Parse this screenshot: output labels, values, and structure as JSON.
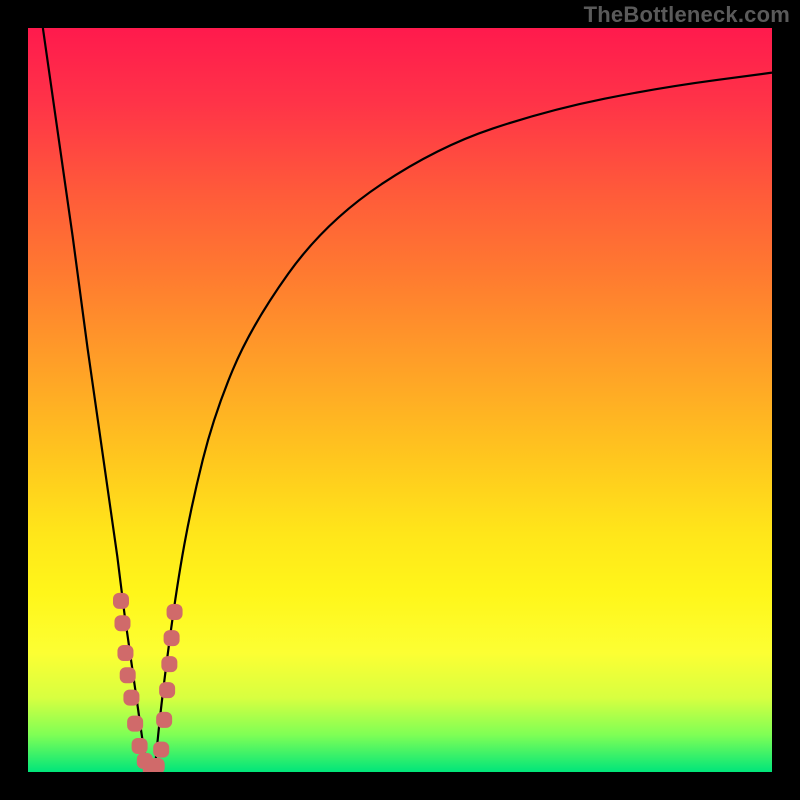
{
  "watermark": "TheBottleneck.com",
  "colors": {
    "frame": "#000000",
    "gradient_top": "#ff1a4d",
    "gradient_bottom": "#00e57a",
    "curve": "#000000",
    "marker": "#d06a6a"
  },
  "chart_data": {
    "type": "line",
    "title": "",
    "xlabel": "",
    "ylabel": "",
    "xlim": [
      0,
      100
    ],
    "ylim": [
      0,
      100
    ],
    "grid": false,
    "series": [
      {
        "name": "left-branch",
        "x": [
          2,
          4,
          6,
          8,
          10,
          12,
          13,
          14,
          15,
          16
        ],
        "values": [
          100,
          86,
          72,
          57,
          43,
          29,
          21,
          14,
          7,
          0
        ]
      },
      {
        "name": "right-branch",
        "x": [
          17,
          18,
          20,
          22,
          25,
          30,
          40,
          55,
          70,
          85,
          100
        ],
        "values": [
          0,
          10,
          25,
          36,
          48,
          60,
          74,
          84,
          89,
          92,
          94
        ]
      }
    ],
    "markers": [
      {
        "series": "left-branch",
        "x": 12.5,
        "y": 23
      },
      {
        "series": "left-branch",
        "x": 12.7,
        "y": 20
      },
      {
        "series": "left-branch",
        "x": 13.1,
        "y": 16
      },
      {
        "series": "left-branch",
        "x": 13.4,
        "y": 13
      },
      {
        "series": "left-branch",
        "x": 13.9,
        "y": 10
      },
      {
        "series": "left-branch",
        "x": 14.4,
        "y": 6.5
      },
      {
        "series": "left-branch",
        "x": 15.0,
        "y": 3.5
      },
      {
        "series": "left-branch",
        "x": 15.7,
        "y": 1.5
      },
      {
        "series": "bottom",
        "x": 16.5,
        "y": 0.5
      },
      {
        "series": "bottom",
        "x": 17.3,
        "y": 0.8
      },
      {
        "series": "right-branch",
        "x": 17.9,
        "y": 3.0
      },
      {
        "series": "right-branch",
        "x": 18.3,
        "y": 7.0
      },
      {
        "series": "right-branch",
        "x": 18.7,
        "y": 11.0
      },
      {
        "series": "right-branch",
        "x": 19.0,
        "y": 14.5
      },
      {
        "series": "right-branch",
        "x": 19.3,
        "y": 18.0
      },
      {
        "series": "right-branch",
        "x": 19.7,
        "y": 21.5
      }
    ],
    "background_gradient": "bottleneck-heatmap"
  }
}
